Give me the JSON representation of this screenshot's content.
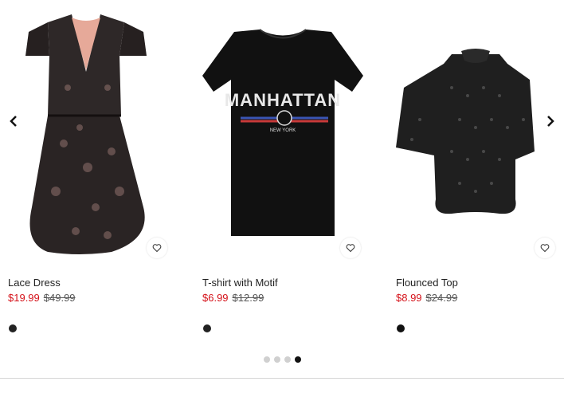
{
  "carousel": {
    "products": [
      {
        "name": "Lace Dress",
        "price": "$19.99",
        "old_price": "$49.99",
        "swatch_color": "#222222",
        "favorite_icon": "heart-icon"
      },
      {
        "name": "T-shirt with Motif",
        "price": "$6.99",
        "old_price": "$12.99",
        "swatch_color": "#222222",
        "favorite_icon": "heart-icon",
        "print": {
          "main": "MANHATTAN",
          "sub": "NEW YORK"
        }
      },
      {
        "name": "Flounced Top",
        "price": "$8.99",
        "old_price": "$24.99",
        "swatch_color": "#111111",
        "favorite_icon": "heart-icon"
      }
    ],
    "prev_icon": "chevron-left-icon",
    "next_icon": "chevron-right-icon",
    "pagination": {
      "total": 4,
      "active": 4
    }
  },
  "colors": {
    "sale_price": "#d5121a",
    "old_price": "#555555",
    "dot_active": "#111111",
    "dot_inactive": "#d0d0d0"
  }
}
